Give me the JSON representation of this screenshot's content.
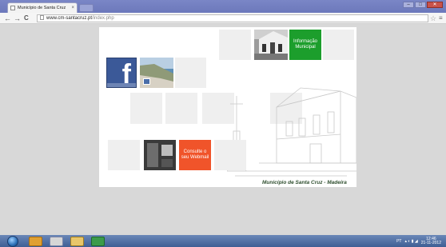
{
  "browser": {
    "tab_title": "Município de Santa Cruz",
    "tab_close": "×",
    "address_host": "www.cm-santacruz.pt",
    "address_path": "/index.php",
    "back_glyph": "←",
    "forward_glyph": "→",
    "reload_glyph": "C",
    "star_glyph": "☆",
    "menu_glyph": "≡",
    "window_controls": {
      "minimize": "–",
      "maximize": "□",
      "close": "✕"
    }
  },
  "page": {
    "facebook_letter": "f",
    "info_button": "Informação Municipal",
    "webmail_button": "Consulte o seu Webmail",
    "footer_title": "Município de Santa Cruz - Madeira"
  },
  "taskbar": {
    "language": "PT",
    "time": "12:46",
    "date": "21-11-2012"
  },
  "colors": {
    "info_green": "#1c9e2c",
    "webmail_orange": "#f0542a",
    "facebook_blue": "#3b5998"
  },
  "icons": [
    "page-icon",
    "star-icon",
    "menu-icon",
    "facebook-icon",
    "like-icon",
    "windows-start-icon",
    "explorer-icon",
    "chrome-icon",
    "folder-icon",
    "excel-icon"
  ]
}
